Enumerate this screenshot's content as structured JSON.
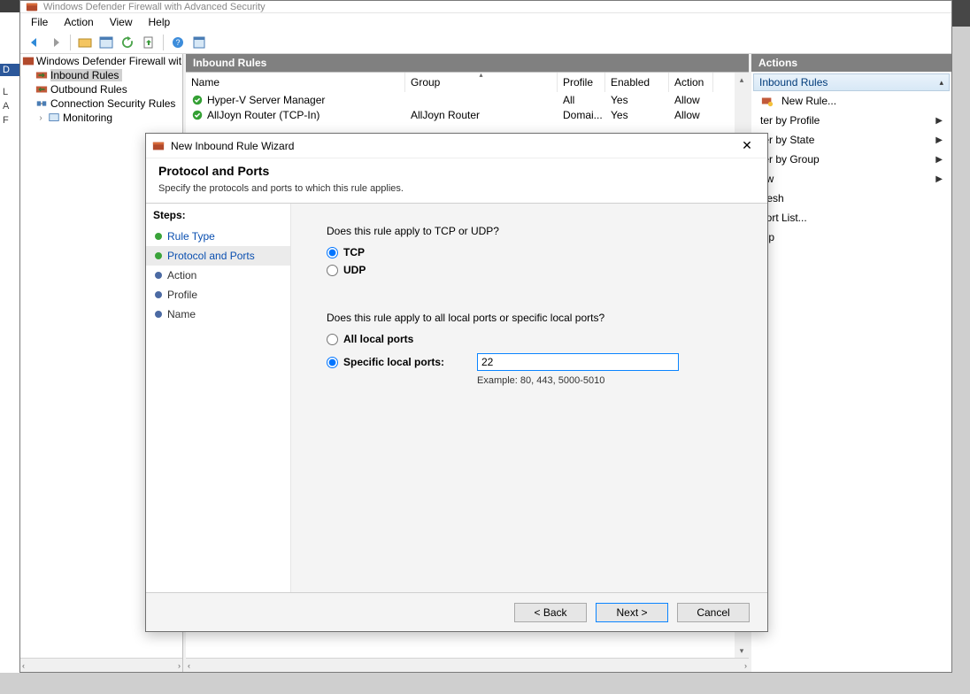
{
  "titlebar": {
    "app_title": "Windows Defender Firewall with Advanced Security"
  },
  "menu": {
    "file": "File",
    "action": "Action",
    "view": "View",
    "help": "Help"
  },
  "tree": {
    "root": "Windows Defender Firewall wit",
    "inbound": "Inbound Rules",
    "outbound": "Outbound Rules",
    "connsec": "Connection Security Rules",
    "monitoring": "Monitoring"
  },
  "center": {
    "header": "Inbound Rules",
    "columns": {
      "name": "Name",
      "group": "Group",
      "profile": "Profile",
      "enabled": "Enabled",
      "action": "Action"
    },
    "rows": [
      {
        "name": "Hyper-V Server Manager",
        "group": "",
        "profile": "All",
        "enabled": "Yes",
        "action": "Allow"
      },
      {
        "name": "AllJoyn Router (TCP-In)",
        "group": "AllJoyn Router",
        "profile": "Domai...",
        "enabled": "Yes",
        "action": "Allow"
      }
    ]
  },
  "actions": {
    "header": "Actions",
    "subheader": "Inbound Rules",
    "new_rule": "New Rule...",
    "filter_profile": "ter by Profile",
    "filter_state": "ter by State",
    "filter_group": "ter by Group",
    "view": "ew",
    "refresh": "fresh",
    "export": "port List...",
    "help": "elp"
  },
  "wizard": {
    "title": "New Inbound Rule Wizard",
    "head_title": "Protocol and Ports",
    "head_desc": "Specify the protocols and ports to which this rule applies.",
    "steps_label": "Steps:",
    "steps": {
      "rule_type": "Rule Type",
      "protocol_ports": "Protocol and Ports",
      "action": "Action",
      "profile": "Profile",
      "name": "Name"
    },
    "q_proto": "Does this rule apply to TCP or UDP?",
    "tcp": "TCP",
    "udp": "UDP",
    "q_ports": "Does this rule apply to all local ports or specific local ports?",
    "all_ports": "All local ports",
    "specific_ports": "Specific local ports:",
    "port_value": "22",
    "example": "Example: 80, 443, 5000-5010",
    "btn_back": "< Back",
    "btn_next": "Next >",
    "btn_cancel": "Cancel"
  }
}
